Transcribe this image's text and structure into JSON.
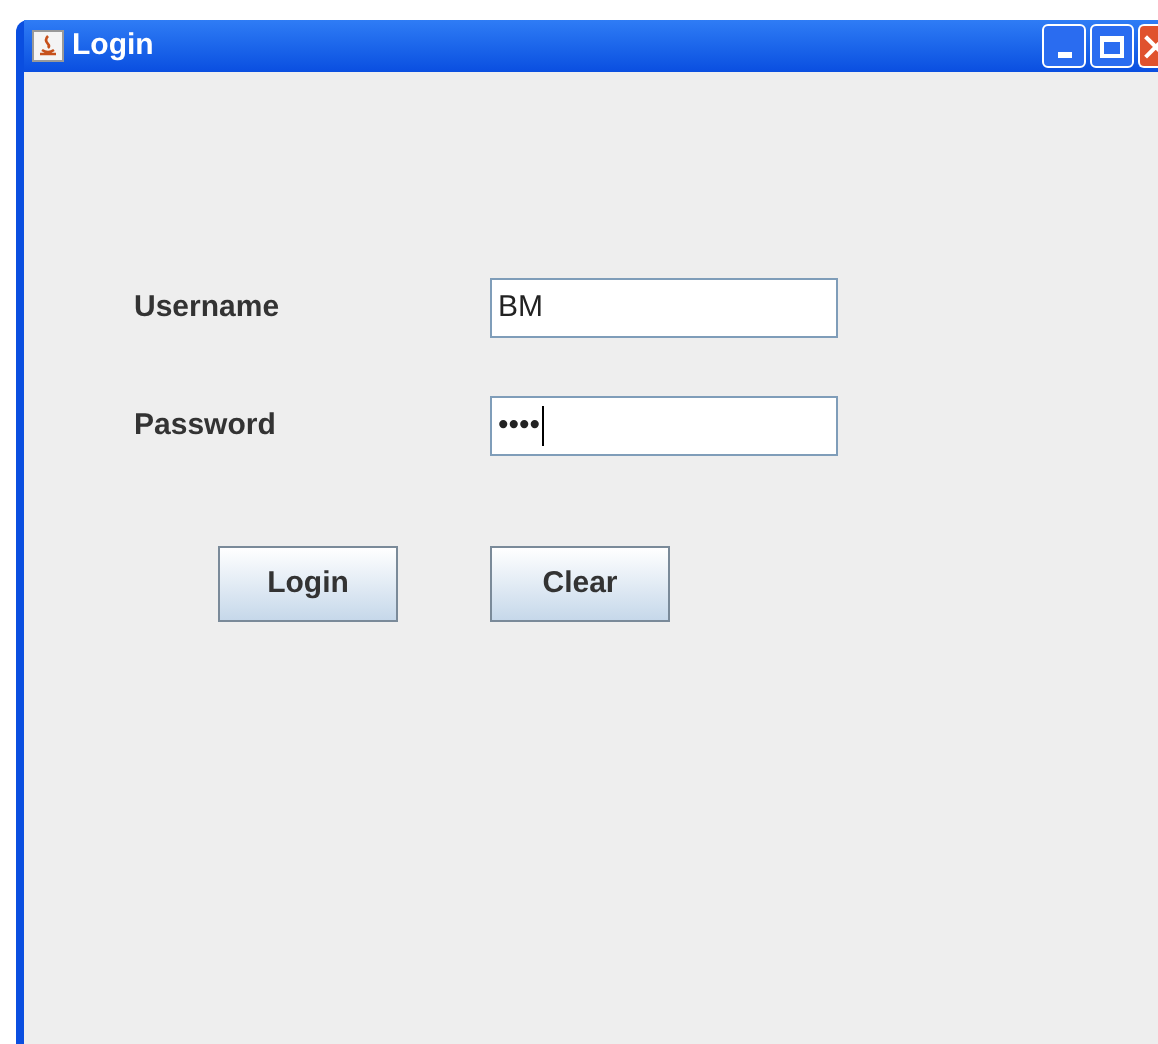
{
  "window": {
    "title": "Login"
  },
  "fields": [
    {
      "label": "Username",
      "value": "BM"
    },
    {
      "label": "Password",
      "value": "••••"
    }
  ],
  "buttons": [
    "Login",
    "Clear"
  ]
}
